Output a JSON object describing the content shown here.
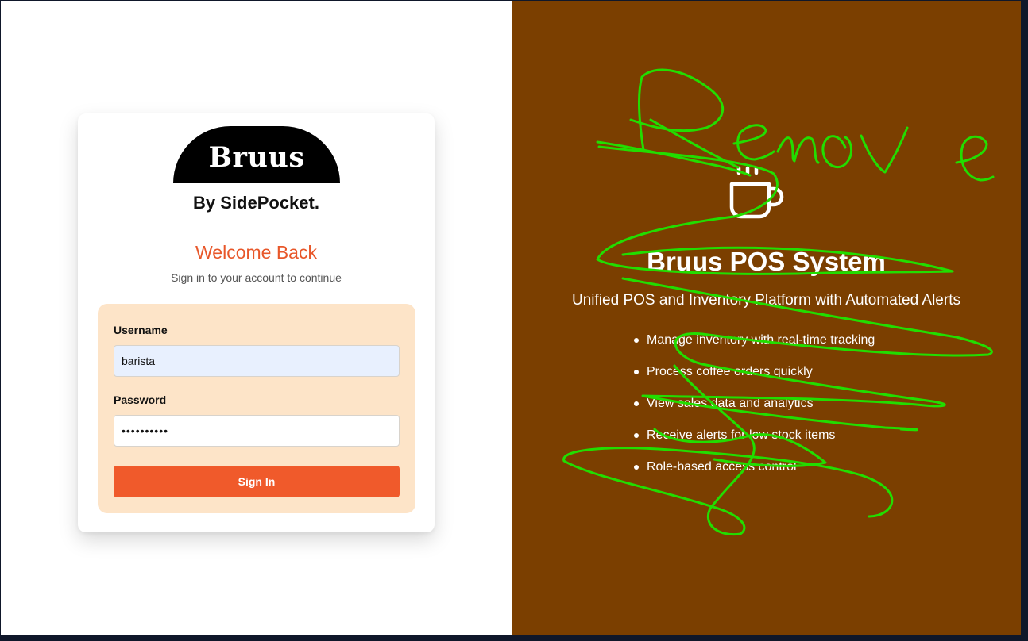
{
  "login": {
    "logo_text": "Bruus",
    "brand_subtitle": "By SidePocket.",
    "welcome_title": "Welcome Back",
    "welcome_subtitle": "Sign in to your account to continue",
    "form": {
      "username_label": "Username",
      "username_value": "barista",
      "password_label": "Password",
      "password_value": "••••••••••",
      "signin_label": "Sign In"
    }
  },
  "hero": {
    "icon": "coffee-cup-icon",
    "title": "Bruus POS System",
    "tagline": "Unified POS and Inventory Platform with Automated Alerts",
    "features": [
      "Manage inventory with real-time tracking",
      "Process coffee orders quickly",
      "View sales data and analytics",
      "Receive alerts for low stock items",
      "Role-based access control"
    ]
  },
  "annotation": {
    "handwritten_text": "Remove",
    "color": "#22dd00"
  },
  "colors": {
    "accent": "#f05a2b",
    "welcome": "#e8572a",
    "hero_background": "#7b3f00",
    "form_background": "#fde4c8"
  }
}
